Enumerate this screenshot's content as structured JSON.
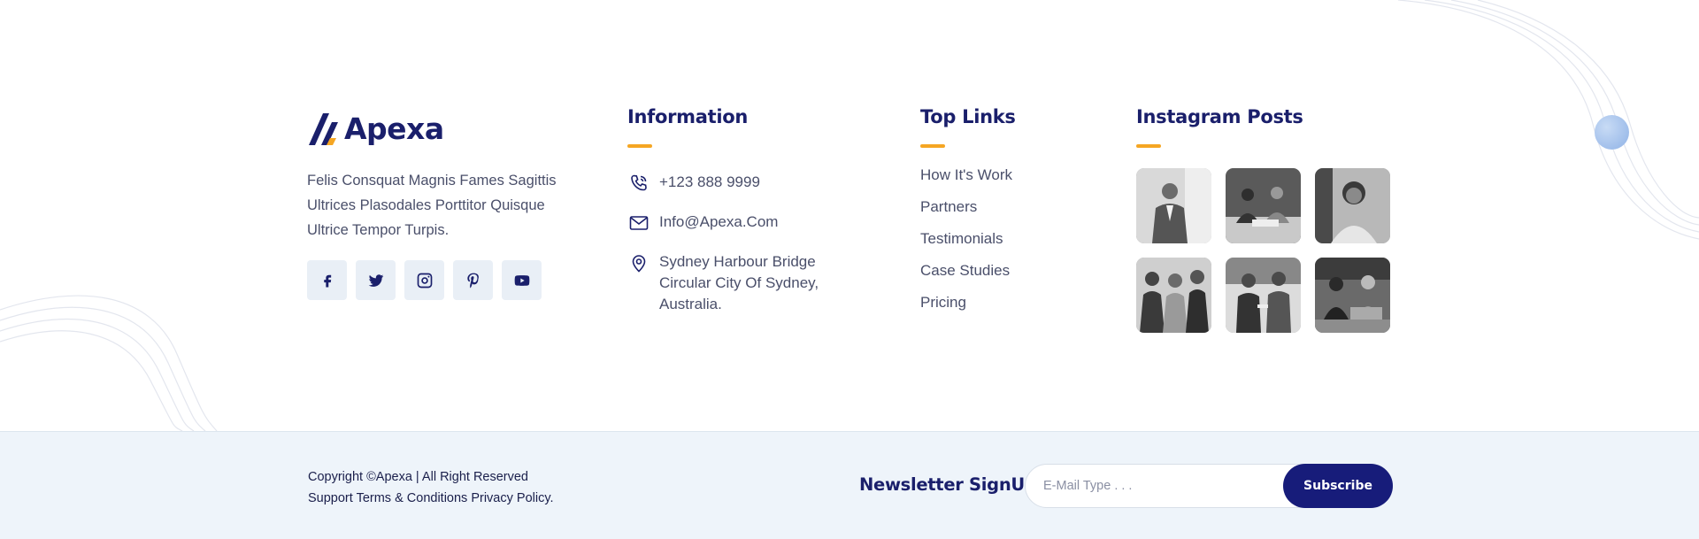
{
  "brand": {
    "name": "Apexa",
    "description": "Felis Consquat Magnis Fames Sagittis Ultrices Plasodales Porttitor Quisque Ultrice Tempor Turpis.",
    "socials": [
      "facebook-icon",
      "twitter-icon",
      "instagram-icon",
      "pinterest-icon",
      "youtube-icon"
    ]
  },
  "information": {
    "title": "Information",
    "phone": "+123 888 9999",
    "email": "Info@Apexa.Com",
    "address": "Sydney Harbour Bridge Circular City Of Sydney, Australia."
  },
  "top_links": {
    "title": "Top Links",
    "items": [
      "How It's Work",
      "Partners",
      "Testimonials",
      "Case Studies",
      "Pricing"
    ]
  },
  "instagram": {
    "title": "Instagram Posts",
    "tiles": [
      "photo-man-suit",
      "photo-team-meeting",
      "photo-woman-smiling",
      "photo-team-group",
      "photo-business-handshake",
      "photo-laptop-work"
    ]
  },
  "footer_bottom": {
    "copyright": "Copyright ©Apexa |",
    "rights": "All Right Reserved",
    "support": "Support",
    "terms": "Terms & Conditions",
    "privacy": "Privacy Policy."
  },
  "newsletter": {
    "title": "Newsletter SignUp!",
    "placeholder": "E-Mail Type . . .",
    "button": "Subscribe"
  },
  "colors": {
    "brand_navy": "#1a1f6b",
    "accent": "#f5a623",
    "bottom_bg": "#eef4fa",
    "button": "#171c7a"
  }
}
